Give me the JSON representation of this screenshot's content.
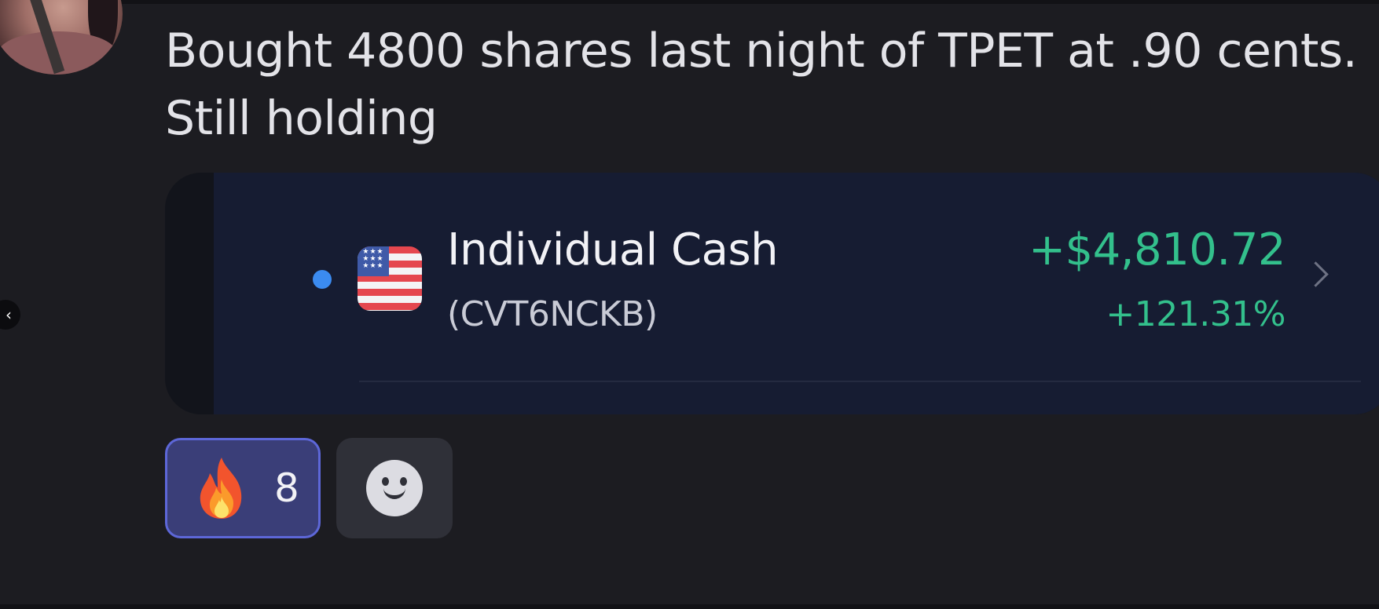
{
  "message": {
    "text_line1": "Bought 4800 shares last night of TPET at .90 cents.",
    "text_line2": "Still holding"
  },
  "embed": {
    "account_name": "Individual Cash",
    "account_id": "(CVT6NCKB)",
    "gain_amount": "+$4,810.72",
    "gain_percent": "+121.31%",
    "status_dot_color": "#3b8bf0",
    "gain_color": "#33c08c",
    "flag_icon": "us-flag-icon",
    "chevron_icon": "chevron-right-icon"
  },
  "reactions": [
    {
      "emoji_icon": "fire-icon",
      "count": "8",
      "selected": true
    }
  ],
  "add_reaction_icon": "smiley-icon",
  "nav": {
    "prev_icon": "chevron-left-icon",
    "prev_glyph": "‹"
  }
}
